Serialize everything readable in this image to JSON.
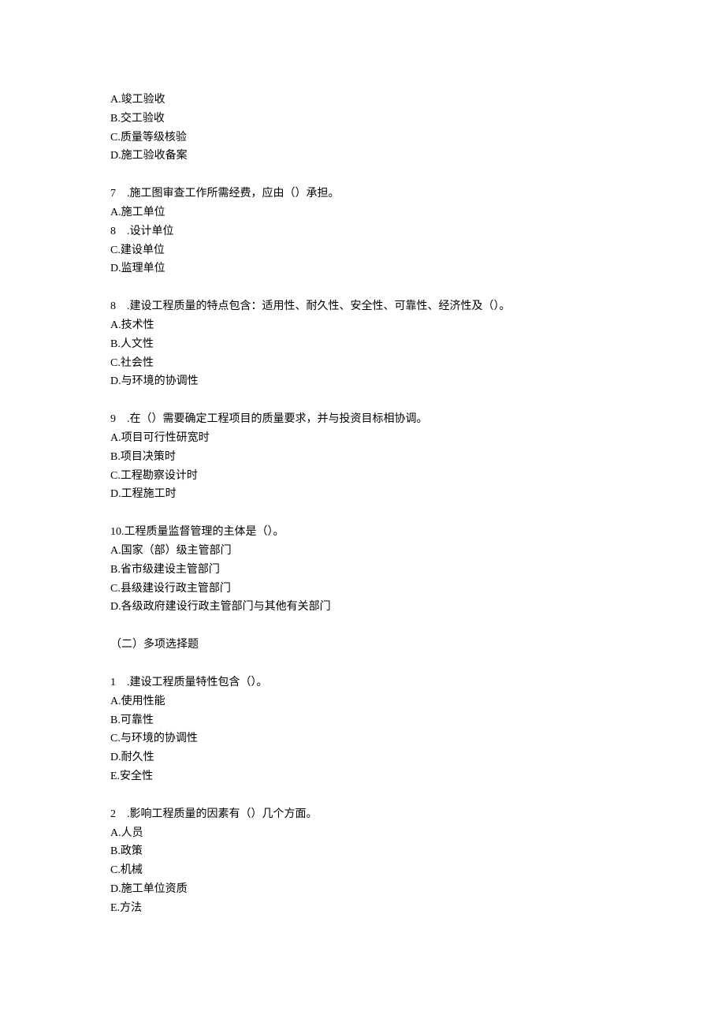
{
  "blocks": [
    {
      "lines": [
        "A.竣工验收",
        "B.交工验收",
        "C.质量等级核验",
        "D.施工验收备案"
      ]
    },
    {
      "lines": [
        "7　.施工图审查工作所需经费，应由（）承担。",
        "A.施工单位",
        "8　.设计单位",
        "C.建设单位",
        "D.监理单位"
      ]
    },
    {
      "lines": [
        "8　.建设工程质量的特点包含：适用性、耐久性、安全性、可靠性、经济性及（）。",
        "A.技术性",
        "B.人文性",
        "C.社会性",
        "D.与环境的协调性"
      ]
    },
    {
      "lines": [
        "9　.在（）需要确定工程项目的质量要求，并与投资目标相协调。",
        "A.项目可行性研宽时",
        "B.项目决策时",
        "C.工程勘察设计时",
        "D.工程施工时"
      ]
    },
    {
      "lines": [
        "10.工程质量监督管理的主体是（）。",
        "A.国家（部）级主管部门",
        "B.省市级建设主管部门",
        "C.县级建设行政主管部门",
        "D.各级政府建设行政主管部门与其他有关部门"
      ]
    },
    {
      "lines": [
        "（二）多项选择题"
      ]
    },
    {
      "lines": [
        "1　.建设工程质量特性包含（）。",
        "A.使用性能",
        "B.可靠性",
        "C.与环境的协调性",
        "D.耐久性",
        "E.安全性"
      ]
    },
    {
      "lines": [
        "2　.影响工程质量的因素有（）几个方面。",
        "A.人员",
        "B.政策",
        "C.机械",
        "D.施工单位资质",
        "E.方法"
      ]
    }
  ]
}
